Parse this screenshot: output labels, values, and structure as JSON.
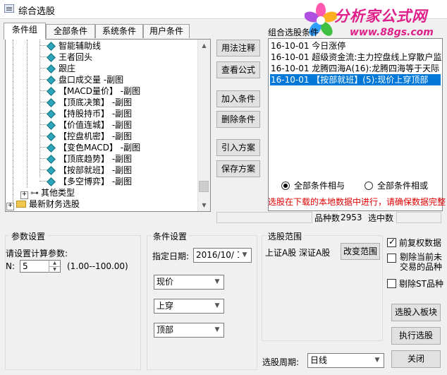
{
  "window": {
    "title": "综合选股"
  },
  "logo": {
    "main": "分析家公式网",
    "url": "www.88gs.com"
  },
  "tabs": [
    {
      "label": "条件组"
    },
    {
      "label": "全部条件"
    },
    {
      "label": "系统条件"
    },
    {
      "label": "用户条件"
    }
  ],
  "tree": {
    "items": [
      {
        "label": "智能辅助线"
      },
      {
        "label": "王者回头"
      },
      {
        "label": "跟庄"
      },
      {
        "label": "盘口成交量 -副图"
      },
      {
        "label": "【MACD量价】 -副图"
      },
      {
        "label": "【顶底决策】 -副图"
      },
      {
        "label": "【持股持币】 -副图"
      },
      {
        "label": "【价值连城】 -副图"
      },
      {
        "label": "【控盘机密】 -副图"
      },
      {
        "label": "【变色MACD】 -副图"
      },
      {
        "label": "【顶底趋势】 -副图"
      },
      {
        "label": "【按部就班】 -副图"
      },
      {
        "label": "【多空博弈】 -副图"
      }
    ],
    "other_type": "其他类型",
    "finance": "最新财务选股"
  },
  "middle_buttons": {
    "usage": "用法注释",
    "view_formula": "查看公式",
    "add_condition": "加入条件",
    "delete_condition": "删除条件",
    "import_plan": "引入方案",
    "save_plan": "保存方案"
  },
  "combo": {
    "label": "组合选股条件",
    "items": [
      {
        "text": "16-10-01 今日涨停",
        "selected": false
      },
      {
        "text": "16-10-01 超级资金流:主力控盘线上穿散户监",
        "selected": false
      },
      {
        "text": "16-10-01 龙腾四海A(16):龙腾四海等于天际",
        "selected": false
      },
      {
        "text": "16-10-01 【按部就班】(5):现价上穿顶部",
        "selected": true
      }
    ]
  },
  "logic": {
    "and_label": "全部条件相与",
    "or_label": "全部条件相或",
    "selected": "and"
  },
  "warning": "选股在下载的本地数据中进行，请确保数据完整",
  "status": {
    "count_label": "品种数",
    "count_value": "2953",
    "selected_label": "选中数",
    "selected_value": ""
  },
  "params": {
    "title": "参数设置",
    "prompt": "请设置计算参数:",
    "n_label": "N:",
    "n_value": "5",
    "range": "(1.00--100.00)"
  },
  "cond": {
    "title": "条件设置",
    "date_label": "指定日期:",
    "date_value": "2016/10/ 1",
    "select1": "现价",
    "select2": "上穿",
    "select3": "顶部"
  },
  "range_box": {
    "title": "选股范围",
    "scope": "上证A股 深证A股",
    "change_btn": "改变范围"
  },
  "options": {
    "fuquan": {
      "label": "前复权数据",
      "checked": true
    },
    "exclude_delist": {
      "label1": "剔除当前未",
      "label2": "交易的品种",
      "checked": false
    },
    "exclude_st": {
      "label": "剔除ST品种",
      "checked": false
    }
  },
  "actions": {
    "to_block": "选股入板块",
    "execute": "执行选股",
    "close": "关闭"
  },
  "period": {
    "label": "选股周期:",
    "value": "日线"
  },
  "colors": {
    "selection": "#0078d7",
    "warning": "#e00000",
    "logo": "#e0208a"
  }
}
